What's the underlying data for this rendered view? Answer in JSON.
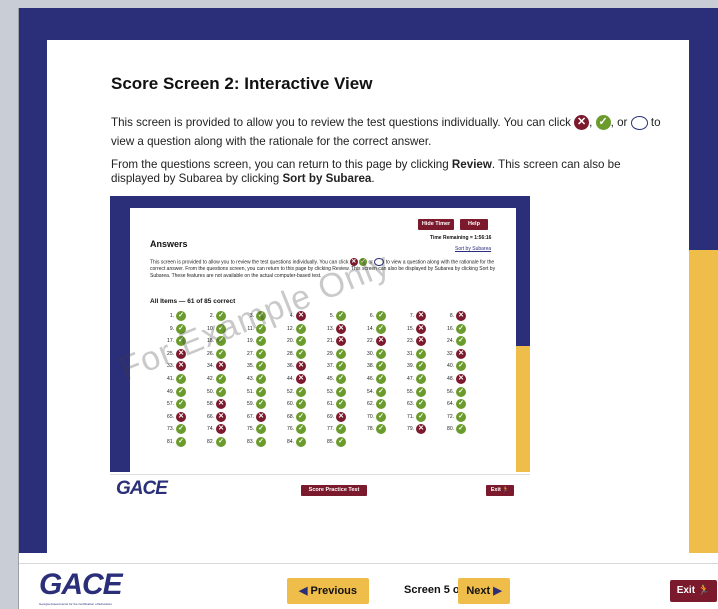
{
  "page": {
    "title": "Score Screen 2: Interactive View",
    "para1_a": "This screen is provided to allow you to review the test questions individually. You can click",
    "para1_b": "or",
    "para1_c": "to view a question along with the rationale for the correct answer.",
    "para2_a": "From the questions screen, you can return to this page by clicking",
    "para2_review": "Review",
    "para2_b": ". This screen can also be displayed by Subarea by clicking",
    "para2_sort": "Sort by Subarea",
    "para2_c": "."
  },
  "inner": {
    "hide_timer": "Hide Timer",
    "help": "Help",
    "time_remaining": "Time Remaining = 1:56:16",
    "sort_link": "Sort by Subarea",
    "answers_title": "Answers",
    "instructions_a": "This screen is provided to allow you to review the test questions individually. You can click",
    "instructions_b": "or",
    "instructions_c": "to view a question along with the rationale for the correct answer. From the questions screen, you can return to this page by clicking Review. This screen can also be displayed by Subarea by clicking Sort by Subarea. These features are not available on the actual computer-based test.",
    "all_items": "All Items — 61 of 85 correct",
    "score_practice": "Score Practice Test",
    "exit": "Exit",
    "watermark": "For Example Only",
    "results": [
      "c",
      "c",
      "c",
      "w",
      "c",
      "c",
      "w",
      "w",
      "c",
      "c",
      "c",
      "c",
      "w",
      "c",
      "w",
      "c",
      "c",
      "c",
      "c",
      "c",
      "w",
      "w",
      "w",
      "c",
      "w",
      "c",
      "c",
      "c",
      "c",
      "c",
      "c",
      "w",
      "w",
      "w",
      "c",
      "w",
      "c",
      "c",
      "c",
      "c",
      "c",
      "c",
      "c",
      "w",
      "c",
      "c",
      "c",
      "w",
      "c",
      "c",
      "c",
      "c",
      "c",
      "c",
      "c",
      "c",
      "c",
      "w",
      "c",
      "c",
      "c",
      "c",
      "c",
      "c",
      "w",
      "w",
      "w",
      "c",
      "w",
      "c",
      "c",
      "c",
      "c",
      "w",
      "c",
      "c",
      "c",
      "c",
      "w",
      "c",
      "c",
      "c",
      "c",
      "c",
      "c"
    ]
  },
  "footer": {
    "logo": "GACE",
    "logo_sub": "Georgia Assessments for the Certification of Educators",
    "previous": "Previous",
    "screen_counter": "Screen 5 of 7",
    "next": "Next",
    "exit": "Exit"
  },
  "icons": {
    "incorrect": "x-circle-icon",
    "correct": "check-circle-icon",
    "unanswered": "empty-oval-icon",
    "exit": "running-person-icon"
  },
  "colors": {
    "navy": "#2b2f7a",
    "gold": "#efbd4a",
    "maroon": "#7b1a2c",
    "green": "#6a9b2c"
  }
}
